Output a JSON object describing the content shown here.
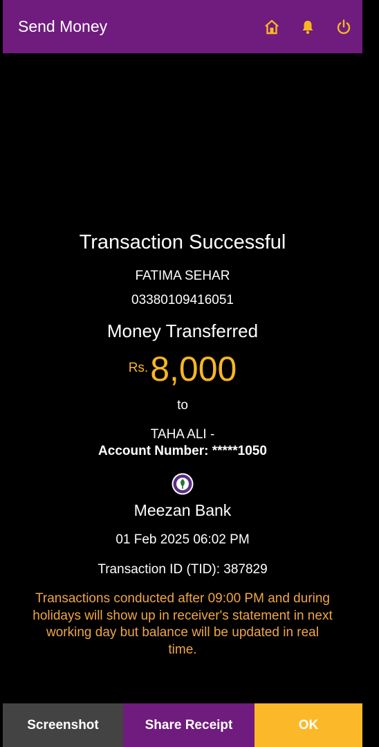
{
  "header": {
    "title": "Send Money",
    "icons": [
      "home-icon",
      "bell-icon",
      "power-icon"
    ],
    "accent_color": "#f8b623",
    "bar_color": "#701b7e"
  },
  "receipt": {
    "status_title": "Transaction Successful",
    "sender_name": "FATIMA SEHAR",
    "sender_number": "03380109416051",
    "transfer_label": "Money Transferred",
    "currency": "Rs.",
    "amount": "8,000",
    "to_word": "to",
    "recipient_name": "TAHA ALI -",
    "account_number_line": "Account Number: *****1050",
    "bank_name": "Meezan Bank",
    "date_time": "01 Feb 2025 06:02 PM",
    "transaction_id": "Transaction ID (TID): 387829",
    "notice": "Transactions conducted after 09:00 PM and during holidays will show up in receiver's statement in next working day but balance will be updated in real time."
  },
  "actions": {
    "screenshot_label": "Screenshot",
    "share_label": "Share Receipt",
    "ok_label": "OK"
  }
}
